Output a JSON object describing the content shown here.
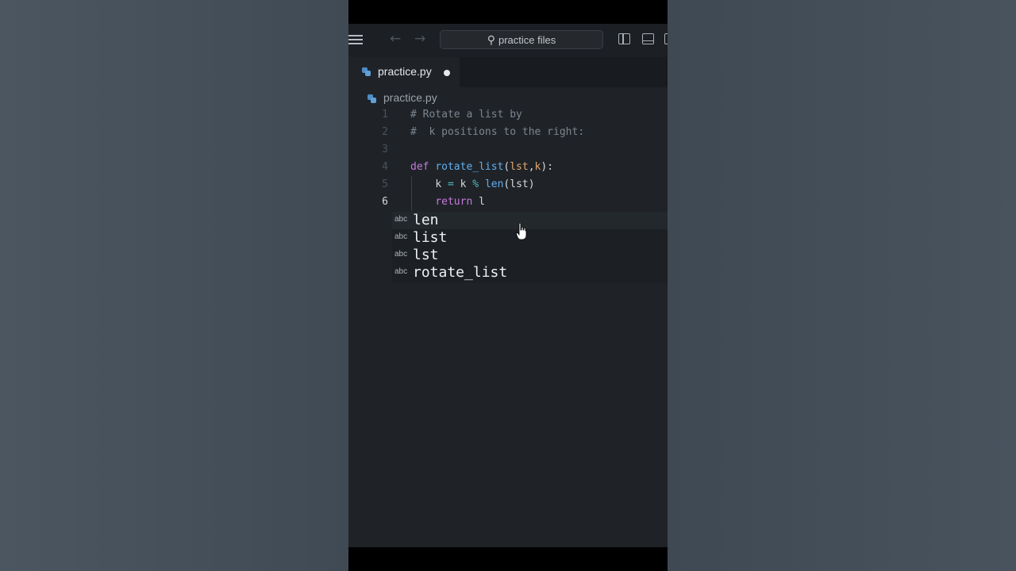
{
  "titlebar": {
    "search_placeholder": "practice files",
    "icons": [
      "menu-icon",
      "arrow-left-icon",
      "arrow-right-icon",
      "search-icon",
      "toggle-sidebar-icon",
      "toggle-panel-icon",
      "toggle-secondary-sidebar-icon"
    ]
  },
  "tab": {
    "label": "practice.py",
    "modified": true
  },
  "breadcrumb": {
    "file": "practice.py"
  },
  "editor": {
    "active_line": 6,
    "lines": [
      {
        "num": "1",
        "text": "# Rotate a list by"
      },
      {
        "num": "2",
        "text": "#  k positions to the right:"
      },
      {
        "num": "3",
        "text": ""
      },
      {
        "num": "4",
        "text": "def rotate_list(lst,k):"
      },
      {
        "num": "5",
        "text": "    k = k % len(lst)"
      },
      {
        "num": "6",
        "text": "    return l"
      }
    ]
  },
  "suggestions": {
    "items": [
      {
        "kind": "abc",
        "label": "len"
      },
      {
        "kind": "abc",
        "label": "list"
      },
      {
        "kind": "abc",
        "label": "lst"
      },
      {
        "kind": "abc",
        "label": "rotate_list"
      }
    ]
  },
  "colors": {
    "keyword": "#c678dd",
    "function": "#61afef",
    "parameter": "#e5a46b",
    "operator": "#56b6c2",
    "comment": "#7d8590",
    "editor_bg": "#1f2328"
  }
}
